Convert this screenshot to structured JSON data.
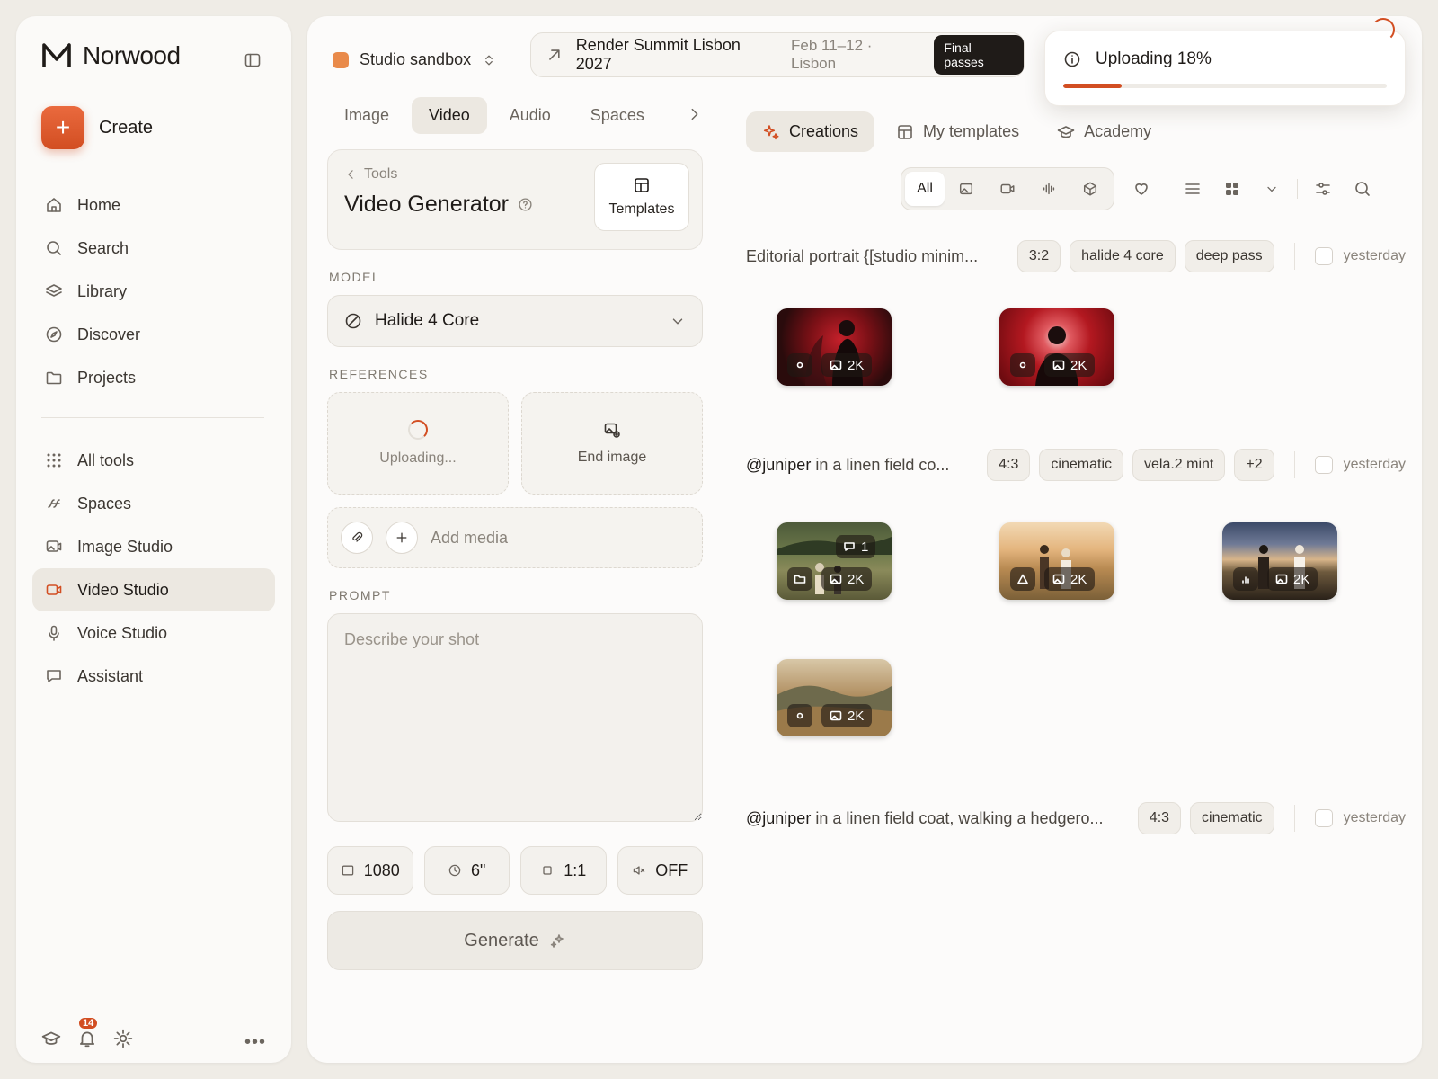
{
  "app": {
    "name": "Norwood"
  },
  "sidebar": {
    "create_label": "Create",
    "primary": [
      {
        "label": "Home",
        "icon": "home-icon"
      },
      {
        "label": "Search",
        "icon": "search-icon"
      },
      {
        "label": "Library",
        "icon": "layers-icon"
      },
      {
        "label": "Discover",
        "icon": "compass-icon"
      },
      {
        "label": "Projects",
        "icon": "folder-icon"
      }
    ],
    "secondary": [
      {
        "label": "All tools",
        "icon": "grid-dots-icon"
      },
      {
        "label": "Spaces",
        "icon": "squiggle-icon"
      },
      {
        "label": "Image Studio",
        "icon": "image-studio-icon"
      },
      {
        "label": "Video Studio",
        "icon": "video-camera-icon",
        "active": true
      },
      {
        "label": "Voice Studio",
        "icon": "microphone-icon"
      },
      {
        "label": "Assistant",
        "icon": "chat-icon"
      }
    ],
    "notification_count": "14"
  },
  "header": {
    "workspace": "Studio sandbox",
    "event_title": "Render Summit Lisbon 2027",
    "event_date": "Feb 11–12 · Lisbon",
    "event_badge": "Final passes"
  },
  "upload_toast": {
    "text": "Uploading 18%",
    "progress": 0.18
  },
  "generator": {
    "tabs": [
      {
        "label": "Image"
      },
      {
        "label": "Video",
        "active": true
      },
      {
        "label": "Audio"
      },
      {
        "label": "Spaces"
      }
    ],
    "breadcrumb": "Tools",
    "title": "Video Generator",
    "templates_label": "Templates",
    "model_label": "MODEL",
    "model_value": "Halide 4 Core",
    "references_label": "REFERENCES",
    "ref_uploading": "Uploading...",
    "ref_end": "End image",
    "add_media": "Add media",
    "prompt_label": "PROMPT",
    "prompt_placeholder": "Describe your shot",
    "params": {
      "resolution": "1080",
      "duration": "6\"",
      "aspect": "1:1",
      "audio": "OFF"
    },
    "generate_label": "Generate"
  },
  "gallery": {
    "tabs": [
      {
        "label": "Creations",
        "active": true
      },
      {
        "label": "My templates"
      },
      {
        "label": "Academy"
      }
    ],
    "filter_all": "All",
    "rows": [
      {
        "prompt_mention": "",
        "prompt_text": "Editorial portrait {[studio minim...",
        "tags": [
          "3:2",
          "halide 4 core",
          "deep pass"
        ],
        "when": "yesterday"
      },
      {
        "prompt_mention": "@juniper",
        "prompt_text": " in a linen field co...",
        "tags": [
          "4:3",
          "cinematic",
          "vela.2 mint",
          "+2"
        ],
        "when": "yesterday"
      },
      {
        "prompt_mention": "@juniper",
        "prompt_text": " in a linen field coat, walking a hedgero...",
        "tags": [
          "4:3",
          "cinematic"
        ],
        "when": "yesterday"
      }
    ],
    "thumbs": [
      {
        "res": "2K",
        "comments": ""
      },
      {
        "res": "2K",
        "comments": ""
      },
      {
        "res": "2K",
        "comments": "1"
      },
      {
        "res": "2K",
        "comments": ""
      },
      {
        "res": "2K",
        "comments": ""
      },
      {
        "res": "2K",
        "comments": ""
      }
    ]
  },
  "colors": {
    "accent": "#d24e22",
    "bg": "#efece6",
    "panel": "#fcfbfa"
  }
}
